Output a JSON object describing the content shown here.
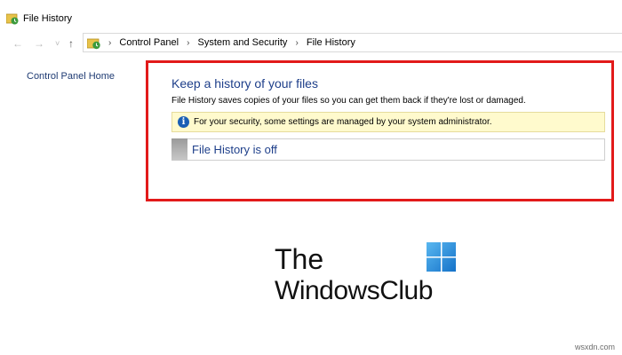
{
  "window": {
    "title": "File History"
  },
  "nav": {
    "back": "←",
    "forward": "→",
    "recent": "˅",
    "up": "↑"
  },
  "breadcrumb": [
    "Control Panel",
    "System and Security",
    "File History"
  ],
  "sidebar": {
    "home_link": "Control Panel Home"
  },
  "main": {
    "heading": "Keep a history of your files",
    "description": "File History saves copies of your files so you can get them back if they're lost or damaged.",
    "notice": "For your security, some settings are managed by your system administrator.",
    "status": "File History is off"
  },
  "logo": {
    "line1": "The",
    "line2": "WindowsClub"
  },
  "watermark": "wsxdn.com",
  "colors": {
    "highlight": "#e21a1a",
    "heading": "#1e3f8a",
    "notice_bg": "#fffacd",
    "link": "#1f3b73"
  }
}
